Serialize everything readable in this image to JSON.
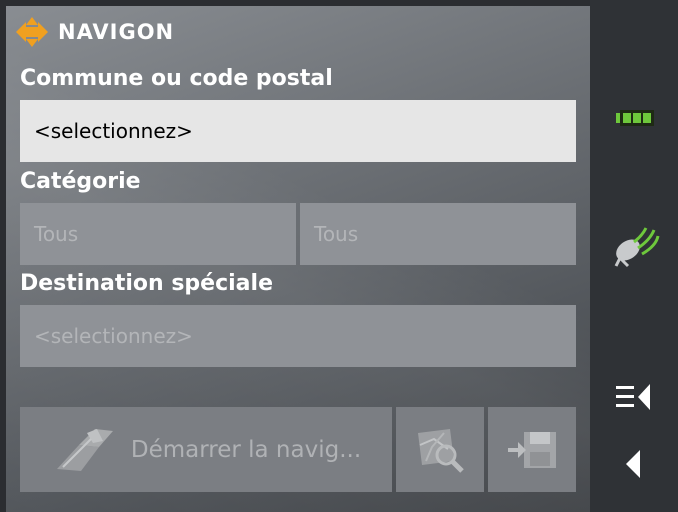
{
  "brand": {
    "name": "NAVIGON"
  },
  "form": {
    "commune_label": "Commune ou code postal",
    "commune_value": "<selectionnez>",
    "categorie_label": "Catégorie",
    "categorie_value_1": "Tous",
    "categorie_value_2": "Tous",
    "destination_label": "Destination spéciale",
    "destination_value": "<selectionnez>"
  },
  "actions": {
    "start_label": "Démarrer la navig..."
  },
  "icons": {
    "brand": "navigon-logo-icon",
    "start": "navigation-start-icon",
    "map": "map-search-icon",
    "save": "save-icon",
    "battery": "battery-icon",
    "gps": "gps-satellite-icon",
    "menu": "menu-icon",
    "back": "back-icon"
  },
  "colors": {
    "logo": "#f0a020",
    "battery": "#6ec83c",
    "gps": "#6ec83c"
  }
}
